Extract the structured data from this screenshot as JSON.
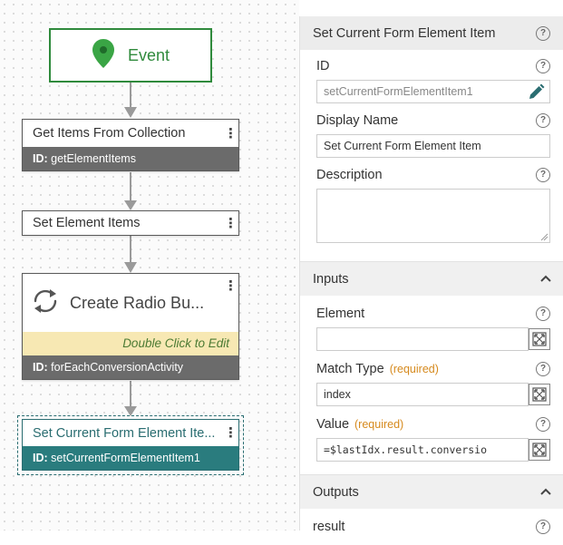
{
  "canvas": {
    "event_node": {
      "label": "Event",
      "icon": "map-pin-icon",
      "accent": "#2f8a3c"
    },
    "nodes": [
      {
        "title": "Get Items From Collection",
        "id_label": "ID:",
        "id_value": "getElementItems"
      },
      {
        "title": "Set Element Items"
      },
      {
        "title": "Create Radio Bu...",
        "hint": "Double Click to Edit",
        "id_label": "ID:",
        "id_value": "forEachConversionActivity",
        "icon": "loop-icon"
      },
      {
        "title": "Set Current Form Element Ite...",
        "id_label": "ID:",
        "id_value": "setCurrentFormElementItem1",
        "selected": true,
        "accent": "#2a7c7e"
      }
    ]
  },
  "panel": {
    "title": "Set Current Form Element Item",
    "fields": {
      "id": {
        "label": "ID",
        "value": "setCurrentFormElementItem1"
      },
      "display_name": {
        "label": "Display Name",
        "value": "Set Current Form Element Item"
      },
      "description": {
        "label": "Description",
        "value": ""
      }
    },
    "inputs": {
      "header": "Inputs",
      "element": {
        "label": "Element",
        "value": ""
      },
      "match_type": {
        "label": "Match Type",
        "required": "(required)",
        "value": "index"
      },
      "value": {
        "label": "Value",
        "required": "(required)",
        "value": "=$lastIdx.result.conversio"
      }
    },
    "outputs": {
      "header": "Outputs",
      "items": [
        {
          "label": "result"
        }
      ]
    },
    "help_glyph": "?",
    "required_color": "#d68a1e"
  }
}
